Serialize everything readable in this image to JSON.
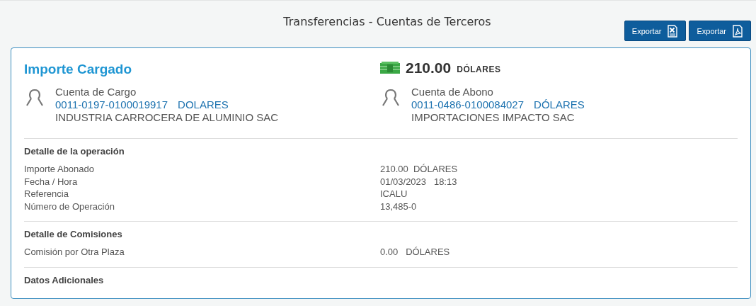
{
  "page_title": "Transferencias - Cuentas de Terceros",
  "export_buttons": [
    {
      "label": "Exportar",
      "kind": "excel"
    },
    {
      "label": "Exportar",
      "kind": "pdf"
    }
  ],
  "summary": {
    "heading": "Importe Cargado",
    "amount": "210.00",
    "currency": "DÓLARES"
  },
  "accounts": [
    {
      "label": "Cuenta de Cargo",
      "number": "0011-0197-0100019917",
      "currency": "DOLARES",
      "holder": "INDUSTRIA CARROCERA DE ALUMINIO SAC"
    },
    {
      "label": "Cuenta de Abono",
      "number": "0011-0486-0100084027",
      "currency": "DÓLARES",
      "holder": "IMPORTACIONES IMPACTO SAC"
    }
  ],
  "sections": [
    {
      "title": "Detalle de la operación",
      "rows": [
        {
          "label": "Importe Abonado",
          "value": "210.00  DÓLARES"
        },
        {
          "label": "Fecha / Hora",
          "value": "01/03/2023   18:13"
        },
        {
          "label": "Referencia",
          "value": "ICALU"
        },
        {
          "label": "Número de Operación",
          "value": "13,485-0"
        }
      ]
    },
    {
      "title": "Detalle de Comisiones",
      "rows": [
        {
          "label": "Comisión por Otra Plaza",
          "value": "0.00   DÓLARES"
        }
      ]
    },
    {
      "title": "Datos Adicionales"
    }
  ]
}
